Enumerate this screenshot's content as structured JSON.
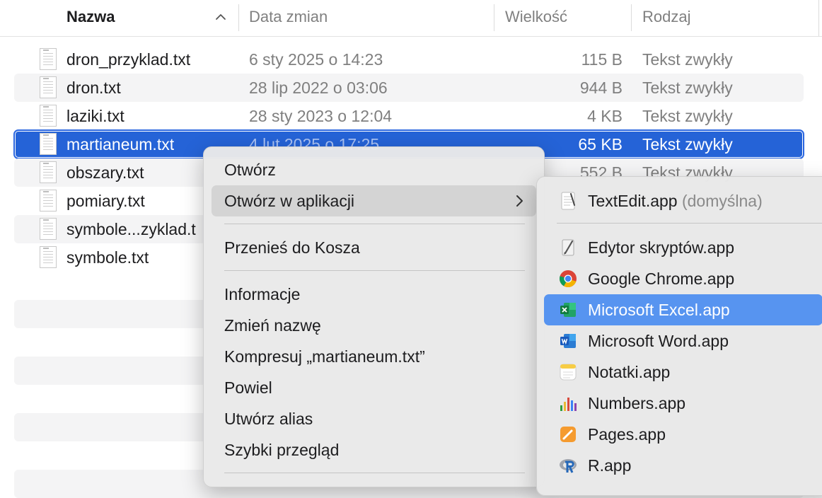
{
  "columns": {
    "name": "Nazwa",
    "date": "Data zmian",
    "size": "Wielkość",
    "kind": "Rodzaj"
  },
  "files": [
    {
      "name": "dron_przyklad.txt",
      "date": "6 sty 2025 o 14:23",
      "size": "115 B",
      "kind": "Tekst zwykły"
    },
    {
      "name": "dron.txt",
      "date": "28 lip 2022 o 03:06",
      "size": "944 B",
      "kind": "Tekst zwykły"
    },
    {
      "name": "laziki.txt",
      "date": "28 sty 2023 o 12:04",
      "size": "4 KB",
      "kind": "Tekst zwykły"
    },
    {
      "name": "martianeum.txt",
      "date": "4 lut 2025 o 17:25",
      "size": "65 KB",
      "kind": "Tekst zwykły"
    },
    {
      "name": "obszary.txt",
      "date": "",
      "size": "552 B",
      "kind": "Tekst zwykły"
    },
    {
      "name": "pomiary.txt",
      "date": "",
      "size": "",
      "kind": ""
    },
    {
      "name": "symbole...zyklad.t",
      "date": "",
      "size": "",
      "kind": ""
    },
    {
      "name": "symbole.txt",
      "date": "",
      "size": "",
      "kind": ""
    }
  ],
  "context_menu": {
    "items": [
      "Otwórz",
      "Otwórz w aplikacji",
      "Przenieś do Kosza",
      "Informacje",
      "Zmień nazwę",
      "Kompresuj „martianeum.txt”",
      "Powiel",
      "Utwórz alias",
      "Szybki przegląd"
    ]
  },
  "submenu": {
    "default_app": "TextEdit.app",
    "default_note": "(domyślna)",
    "apps": [
      "Edytor skryptów.app",
      "Google Chrome.app",
      "Microsoft Excel.app",
      "Microsoft Word.app",
      "Notatki.app",
      "Numbers.app",
      "Pages.app",
      "R.app"
    ]
  },
  "colors": {
    "selection": "#2563d7",
    "submenu_highlight": "#5794f0",
    "menu_background": "#e9e9e9"
  }
}
